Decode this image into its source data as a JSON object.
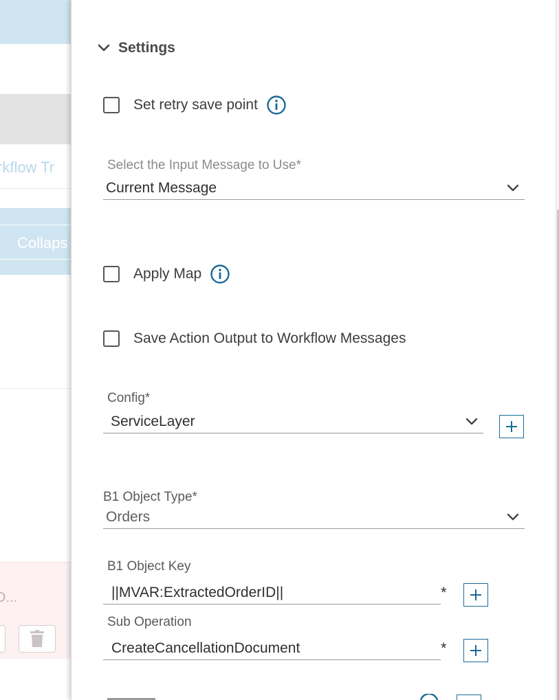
{
  "background": {
    "partial_texts": [
      "rkflow Tr",
      "Collaps",
      "D..."
    ]
  },
  "settings": {
    "title": "Settings",
    "retry_save_point_label": "Set retry save point",
    "input_message": {
      "label": "Select the Input Message to Use*",
      "value": "Current Message"
    },
    "apply_map_label": "Apply Map",
    "save_output_label": "Save Action Output to Workflow Messages",
    "config": {
      "label": "Config*",
      "value": "ServiceLayer"
    },
    "b1_object_type": {
      "label": "B1 Object Type*",
      "value": "Orders"
    },
    "b1_object_key": {
      "label": "B1 Object Key",
      "value": "||MVAR:ExtractedOrderID||",
      "required_marker": "*"
    },
    "sub_operation": {
      "label": "Sub Operation",
      "value": "CreateCancellationDocument",
      "required_marker": "*"
    }
  },
  "colors": {
    "accent": "#1a6a96",
    "light_blue_bg": "#cfe5f1",
    "pink_bg": "#fdf1f2"
  }
}
